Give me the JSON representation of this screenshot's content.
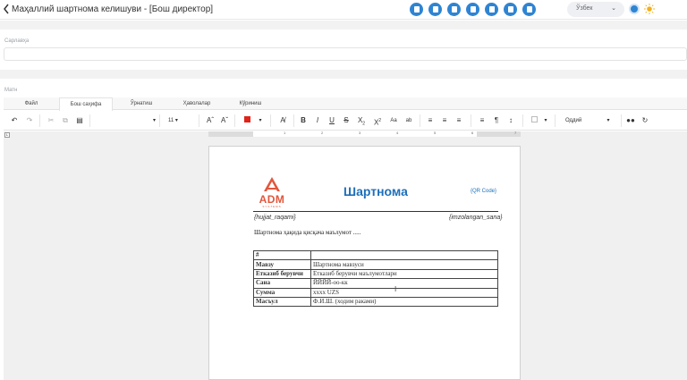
{
  "header": {
    "title": "Маҳаллий шартнома келишуви - [Бош директор]",
    "toolbar_icons": [
      "document-icon",
      "edit-doc-icon",
      "save-doc-icon",
      "calendar-icon",
      "car-icon",
      "calendar-check-icon",
      "calendar-edit-icon"
    ],
    "language": "Ўзбек",
    "accent": "#2e84d3"
  },
  "subject": {
    "label": "Сарлавҳа",
    "value": ""
  },
  "content": {
    "label": "Матн"
  },
  "editor": {
    "tabs": [
      "Файл",
      "Бош саҳифа",
      "Ўрнатиш",
      "Ҳаволалар",
      "Кўриниш"
    ],
    "active_tab": "Бош саҳифа",
    "font_size": "11",
    "style": "Оддий",
    "ruler_numbers": [
      "1",
      "2",
      "3",
      "4",
      "5",
      "6",
      "7"
    ]
  },
  "document": {
    "logo_text": "ADM",
    "logo_sub": "SYSTEMS",
    "title": "Шартнома",
    "qr_label": "{QR Code}",
    "reg_placeholder": "{hujjat_raqami}",
    "sign_date_placeholder": "{imzolangan_sana}",
    "summary": "Шартнома ҳақида қисқача маълумот .....",
    "brand_color": "#e2563b",
    "title_color": "#1d6fbb",
    "rows": [
      {
        "key": "#",
        "value": ""
      },
      {
        "key": "Мавзу",
        "value": "Шартнома мавзуси"
      },
      {
        "key": "Етказиб берувчи",
        "value": "Етказиб берувчи маълумотлари"
      },
      {
        "key": "Сана",
        "value": "ЙЙЙЙ-оо-кк"
      },
      {
        "key": "Сумма",
        "value": "xxxx UZS"
      },
      {
        "key": "Масъул",
        "value": "Ф.И.Ш. (ходим раками)"
      }
    ]
  }
}
